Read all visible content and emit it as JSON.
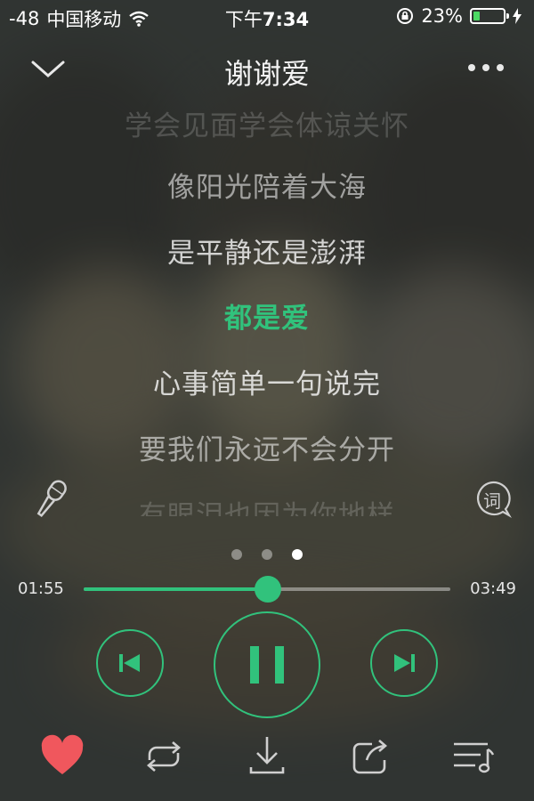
{
  "status_bar": {
    "signal": "-48",
    "carrier": "中国移动",
    "time_prefix": "下午",
    "time": "7:34",
    "battery_text": "23%",
    "battery_level": 0.23,
    "accent": "#4cd964"
  },
  "header": {
    "title": "谢谢爱",
    "back_icon": "chevron-down-icon",
    "more_icon": "more-dots-icon"
  },
  "lyrics": [
    "学会见面学会体谅关怀",
    "像阳光陪着大海",
    "是平静还是澎湃",
    "都是爱",
    "心事简单一句说完",
    "要我们永远不会分开",
    "有眼泪也因为你地样"
  ],
  "active_lyric_index": 3,
  "side_icons": {
    "left": "microphone-icon",
    "right": "lyrics-icon",
    "right_glyph": "词"
  },
  "pager": {
    "count": 3,
    "active": 2
  },
  "playback": {
    "current_time": "01:55",
    "total_time": "03:49",
    "progress": 0.502
  },
  "controls": {
    "prev": "previous-track-icon",
    "play_pause": "pause-icon",
    "next": "next-track-icon"
  },
  "bottom_bar": [
    "heart-icon",
    "repeat-icon",
    "download-icon",
    "share-icon",
    "playlist-icon"
  ],
  "colors": {
    "accent": "#31c27c",
    "heart": "#f0575d"
  }
}
